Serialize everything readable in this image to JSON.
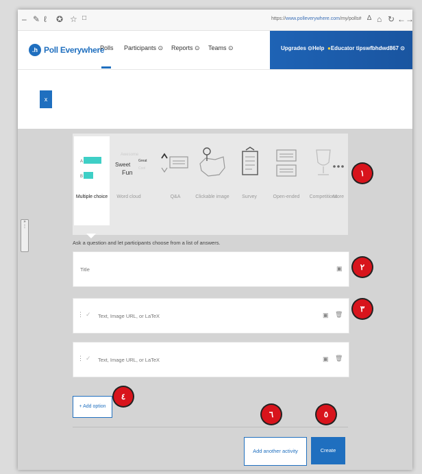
{
  "browser": {
    "url_prefix": "https://",
    "url_domain": "www.polleverywhere.com",
    "url_path": "/my/polls#",
    "icons": [
      "minimize-icon",
      "reading-view-icon",
      "pen-icon",
      "favorites-icon",
      "star-icon",
      "square-icon"
    ],
    "right_icons": [
      "home-icon",
      "refresh-icon",
      "back-icon",
      "forward-icon"
    ]
  },
  "nav": {
    "logo_mark": ".h",
    "logo_text": "Poll Everywhere",
    "items": [
      "Polls",
      "Participants ⊙",
      "Reports ⊙",
      "Teams ⊙"
    ],
    "right": [
      "Upgrades ⊙",
      "Help",
      "Educator tips",
      "wfbhdwd867 ⊙"
    ],
    "active": "Polls"
  },
  "close_btn": "x",
  "activity_types": [
    {
      "label": "Multiple choice",
      "selected": true
    },
    {
      "label": "Word cloud"
    },
    {
      "label": "Q&A"
    },
    {
      "label": "Clickable image"
    },
    {
      "label": "Survey"
    },
    {
      "label": "Open-ended"
    },
    {
      "label": "Competitions"
    },
    {
      "label": "More"
    }
  ],
  "wordcloud_words": {
    "awesome": "Awesome",
    "sweet": "Sweet",
    "great": "Great",
    "fun": "Fun",
    "cool": "Cool"
  },
  "mc_letters": [
    "A",
    "B"
  ],
  "description": "Ask a question and let participants choose from a list of answers.",
  "title_placeholder": "Title",
  "option_placeholder": "Text, Image URL, or LaTeX",
  "add_option": "+ Add option",
  "add_another": "Add another activity",
  "create": "Create",
  "badges": [
    "١",
    "٢",
    "٣",
    "٤",
    "٥",
    "٦"
  ],
  "colors": {
    "brand": "#1f6fbf",
    "badge": "#d8141c",
    "mc_bar": "#3ecfc6"
  }
}
